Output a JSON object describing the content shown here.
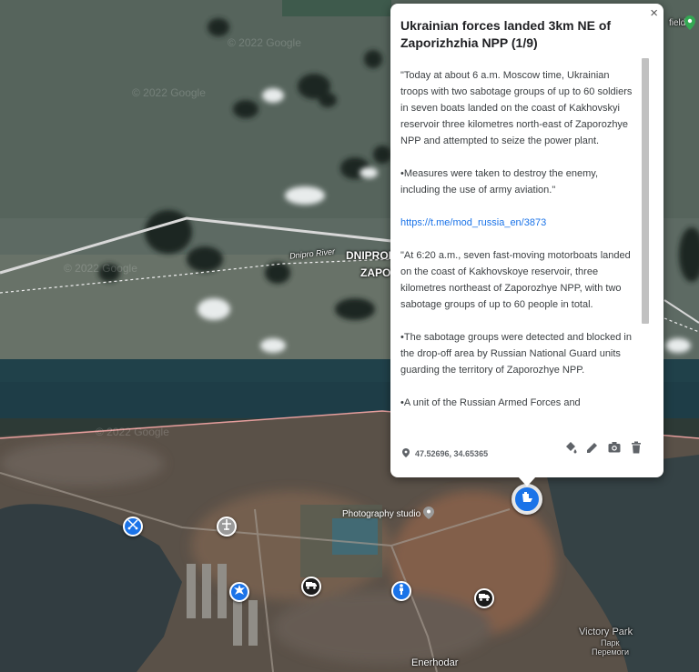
{
  "map": {
    "labels": {
      "city_line1": "DNIPROP",
      "city_line2": "ZAPO",
      "river": "Dnipro River",
      "photo_studio": "Photography studio",
      "victory_park": "Victory Park",
      "victory_park_ru1": "Парк",
      "victory_park_ru2": "Перемоги",
      "enerhodar": "Enerhodar",
      "field": "field"
    },
    "watermarks": [
      "© 2022 Google",
      "© 2022 Google",
      "© 2022 Google",
      "© 2022 Google"
    ],
    "markers": [
      {
        "name": "crossed-swords-marker",
        "color": "blue",
        "icon": "crossed-swords-icon"
      },
      {
        "name": "aircraft-marker",
        "color": "gray",
        "icon": "aircraft-icon"
      },
      {
        "name": "explosion-marker",
        "color": "blue",
        "icon": "explosion-icon"
      },
      {
        "name": "truck-marker",
        "color": "black",
        "icon": "truck-icon"
      },
      {
        "name": "person-marker",
        "color": "blue",
        "icon": "person-icon"
      },
      {
        "name": "truck-marker-2",
        "color": "black",
        "icon": "truck-icon"
      },
      {
        "name": "selected-boat-marker",
        "color": "blue",
        "icon": "boat-icon"
      }
    ]
  },
  "popup": {
    "title": "Ukrainian forces landed 3km NE of Zaporizhzhia NPP (1/9)",
    "close_label": "×",
    "paragraphs": [
      "\"Today at about 6 a.m. Moscow time, Ukrainian troops with two sabotage groups of up to 60 soldiers in seven boats landed on the coast of Kakhovskyi reservoir three kilometres north-east of Zaporozhye NPP and attempted to seize the power plant.",
      "•Measures were taken to destroy the enemy, including the use of army aviation.\""
    ],
    "link": "https://t.me/mod_russia_en/3873",
    "paragraphs2": [
      "\"At 6:20 a.m., seven fast-moving motorboats landed on the coast of Kakhovskoye reservoir, three kilometres northeast of Zaporozhye NPP, with two sabotage groups of up to 60 people in total.",
      "•The sabotage groups were detected and blocked in the drop-off area by Russian National Guard units guarding the territory of Zaporozhye NPP.",
      "•A unit of the Russian Armed Forces and"
    ],
    "coordinates": "47.52696, 34.65365",
    "tools": [
      "paint-bucket-icon",
      "edit-pencil-icon",
      "camera-icon",
      "trash-icon"
    ]
  },
  "colors": {
    "marker_blue": "#1a73e8",
    "link_blue": "#1a73e8",
    "territory_line": "#e8a0a0"
  }
}
